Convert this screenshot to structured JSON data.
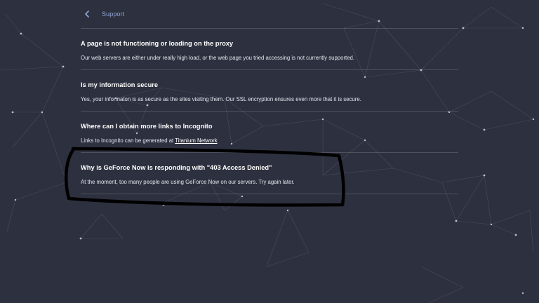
{
  "header": {
    "title": "Support",
    "back_icon": "chevron-left-icon"
  },
  "faq": [
    {
      "question": "A page is not functioning or loading on the proxy",
      "answer": "Our web servers are either under really high load, or the web page you tried accessing is not currently supported."
    },
    {
      "question": "Is my information secure",
      "answer": "Yes, your informaton is as secure as the sites visiting them. Our SSL encryption ensures even more that it is secure."
    },
    {
      "question": "Where can I obtain more links to Incognito",
      "answer_prefix": "Links to Incognito can be generated at ",
      "answer_link": "Titanium Network"
    },
    {
      "question": "Why is GeForce Now is responding with \"403 Access Denied\"",
      "answer": "At the moment, too many people are using GeForce Now on our servers. Try again later."
    }
  ],
  "colors": {
    "background": "#2d303e",
    "header_accent": "#8fa8d8",
    "annotation_stroke": "#000000"
  }
}
